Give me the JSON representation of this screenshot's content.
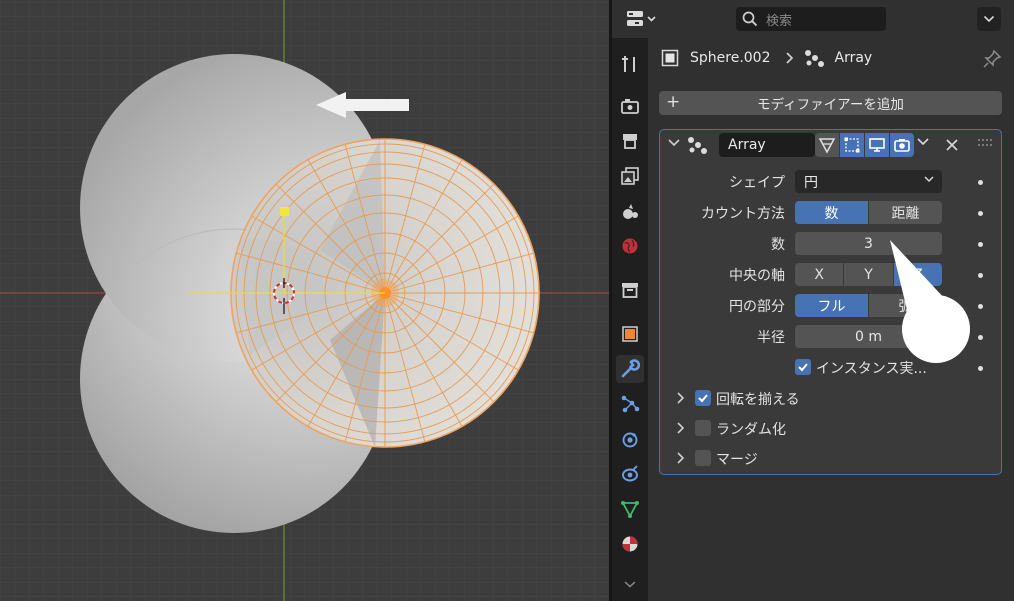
{
  "search": {
    "placeholder": "検索"
  },
  "breadcrumb": {
    "object": "Sphere.002",
    "modifier": "Array"
  },
  "add_modifier_label": "モディファイアーを追加",
  "modifier": {
    "name": "Array",
    "shape": {
      "label": "シェイプ",
      "value": "円"
    },
    "count_method": {
      "label": "カウント方法",
      "options": [
        "数",
        "距離"
      ],
      "selected": "数"
    },
    "count": {
      "label": "数",
      "value": "3"
    },
    "central_axis": {
      "label": "中央の軸",
      "options": [
        "X",
        "Y",
        "Z"
      ],
      "selected": "Z"
    },
    "circle_part": {
      "label": "円の部分",
      "options": [
        "フル",
        "弧"
      ],
      "selected": "フル"
    },
    "radius": {
      "label": "半径",
      "value": "0 m"
    },
    "instance_checkbox": {
      "label": "インスタンス実...",
      "checked": true
    },
    "subpanels": [
      {
        "label": "回転を揃える",
        "checked": true
      },
      {
        "label": "ランダム化",
        "checked": false
      },
      {
        "label": "マージ",
        "checked": false
      }
    ]
  },
  "colors": {
    "accent": "#4772b3",
    "selection": "#f0a35a",
    "x_axis": "#b5404a",
    "y_axis": "#7aa533"
  }
}
